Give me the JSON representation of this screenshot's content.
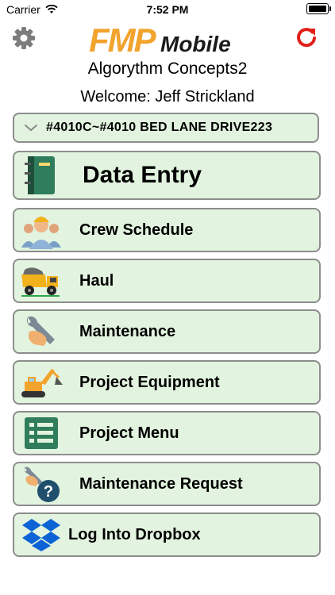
{
  "status_bar": {
    "carrier": "Carrier",
    "time": "7:52 PM"
  },
  "header": {
    "logo_fmp": "FMP",
    "logo_mobile": "Mobile",
    "company": "Algorythm Concepts2",
    "welcome": "Welcome: Jeff Strickland"
  },
  "project": {
    "selected": "#4010C~#4010 BED LANE DRIVE223"
  },
  "menu": {
    "data_entry": "Data Entry",
    "crew_schedule": "Crew Schedule",
    "haul": "Haul",
    "maintenance": "Maintenance",
    "project_equipment": "Project Equipment",
    "project_menu": "Project Menu",
    "maintenance_request": "Maintenance Request",
    "dropbox": "Log Into Dropbox"
  },
  "colors": {
    "button_bg": "#e2f4df",
    "button_border": "#8d8d8d",
    "logo_orange": "#f2a32c",
    "refresh_red": "#e0201a"
  },
  "icons": {
    "settings": "gear-icon",
    "refresh": "refresh-icon",
    "data_entry": "notebook-icon",
    "crew_schedule": "crew-icon",
    "haul": "dump-truck-icon",
    "maintenance": "wrench-icon",
    "project_equipment": "excavator-icon",
    "project_menu": "list-icon",
    "maintenance_request": "wrench-question-icon",
    "dropbox": "dropbox-icon"
  }
}
